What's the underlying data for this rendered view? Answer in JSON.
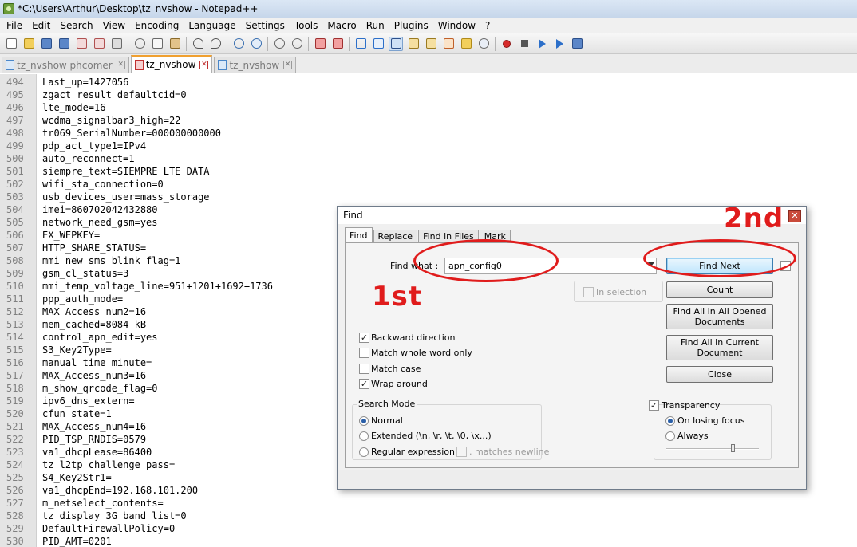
{
  "window": {
    "title": "*C:\\Users\\Arthur\\Desktop\\tz_nvshow - Notepad++"
  },
  "menu": [
    "File",
    "Edit",
    "Search",
    "View",
    "Encoding",
    "Language",
    "Settings",
    "Tools",
    "Macro",
    "Run",
    "Plugins",
    "Window",
    "?"
  ],
  "tabs": [
    {
      "label": "tz_nvshow phcomer",
      "active": false
    },
    {
      "label": "tz_nvshow",
      "active": true
    },
    {
      "label": "tz_nvshow",
      "active": false
    }
  ],
  "lines": [
    {
      "n": "494",
      "text": "Last_up=1427056"
    },
    {
      "n": "495",
      "text": "zgact_result_defaultcid=0"
    },
    {
      "n": "496",
      "text": "lte_mode=16"
    },
    {
      "n": "497",
      "text": "wcdma_signalbar3_high=22"
    },
    {
      "n": "498",
      "text": "tr069_SerialNumber=000000000000"
    },
    {
      "n": "499",
      "text": "pdp_act_type1=IPv4"
    },
    {
      "n": "500",
      "text": "auto_reconnect=1"
    },
    {
      "n": "501",
      "text": "siempre_text=SIEMPRE LTE DATA"
    },
    {
      "n": "502",
      "text": "wifi_sta_connection=0"
    },
    {
      "n": "503",
      "text": "usb_devices_user=mass_storage"
    },
    {
      "n": "504",
      "text": "imei=860702042432880"
    },
    {
      "n": "505",
      "text": "network_need_gsm=yes"
    },
    {
      "n": "506",
      "text": "EX_WEPKEY="
    },
    {
      "n": "507",
      "text": "HTTP_SHARE_STATUS="
    },
    {
      "n": "508",
      "text": "mmi_new_sms_blink_flag=1"
    },
    {
      "n": "509",
      "text": "gsm_cl_status=3"
    },
    {
      "n": "510",
      "text": "mmi_temp_voltage_line=951+1201+1692+1736"
    },
    {
      "n": "511",
      "text": "ppp_auth_mode="
    },
    {
      "n": "512",
      "text": "MAX_Access_num2=16"
    },
    {
      "n": "513",
      "text": "mem_cached=8084 kB"
    },
    {
      "n": "514",
      "text": "control_apn_edit=yes"
    },
    {
      "n": "515",
      "text": "S3_Key2Type="
    },
    {
      "n": "516",
      "text": "manual_time_minute="
    },
    {
      "n": "517",
      "text": "MAX_Access_num3=16"
    },
    {
      "n": "518",
      "text": "m_show_qrcode_flag=0"
    },
    {
      "n": "519",
      "text": "ipv6_dns_extern="
    },
    {
      "n": "520",
      "text": "cfun_state=1"
    },
    {
      "n": "521",
      "text": "MAX_Access_num4=16"
    },
    {
      "n": "522",
      "text": "PID_TSP_RNDIS=0579"
    },
    {
      "n": "523",
      "text": "va1_dhcpLease=86400"
    },
    {
      "n": "524",
      "text": "tz_l2tp_challenge_pass="
    },
    {
      "n": "525",
      "text": "S4_Key2Str1="
    },
    {
      "n": "526",
      "text": "va1_dhcpEnd=192.168.101.200"
    },
    {
      "n": "527",
      "text": "m_netselect_contents="
    },
    {
      "n": "528",
      "text": "tz_display_3G_band_list=0"
    },
    {
      "n": "529",
      "text": "DefaultFirewallPolicy=0"
    },
    {
      "n": "530",
      "text": "PID_AMT=0201"
    }
  ],
  "find_dialog": {
    "title": "Find",
    "close_glyph": "✕",
    "tabs": [
      "Find",
      "Replace",
      "Find in Files",
      "Mark"
    ],
    "find_what_label": "Find what :",
    "find_what_value": "apn_config0",
    "in_selection_label": "In selection",
    "buttons": {
      "find_next": "Find Next",
      "count": "Count",
      "find_all_opened": "Find All in All Opened Documents",
      "find_all_current": "Find All in Current Document",
      "close": "Close"
    },
    "options": [
      {
        "label": "Backward direction",
        "checked": true
      },
      {
        "label": "Match whole word only",
        "checked": false
      },
      {
        "label": "Match case",
        "checked": false
      },
      {
        "label": "Wrap around",
        "checked": true
      }
    ],
    "search_mode": {
      "title": "Search Mode",
      "normal": "Normal",
      "extended": "Extended (\\n, \\r, \\t, \\0, \\x...)",
      "regex": "Regular expression",
      "matches_newline": ". matches newline",
      "selected": "normal"
    },
    "transparency": {
      "label": "Transparency",
      "checked": true,
      "on_losing_focus": "On losing focus",
      "always": "Always",
      "selected": "on_losing_focus"
    }
  },
  "annotations": {
    "first": "1st",
    "second": "2nd"
  },
  "colors": {
    "annotation": "#e01c1c",
    "accent_tab": "#f0a030"
  }
}
